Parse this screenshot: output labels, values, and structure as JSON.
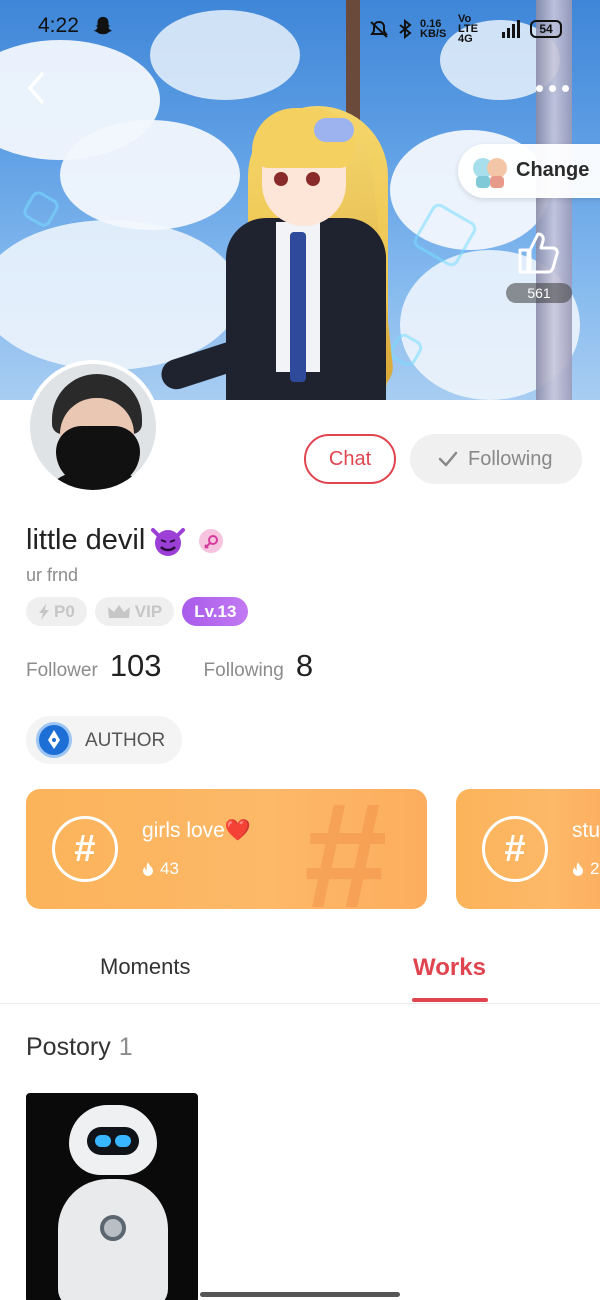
{
  "status_bar": {
    "time": "4:22",
    "net_speed": "0.16 KB/S",
    "network": "Vo LTE 4G",
    "battery": "54"
  },
  "header": {
    "change_label": "Change",
    "like_count": "561"
  },
  "profile": {
    "name": "little devil",
    "bio": "ur frnd",
    "badges": {
      "p0": "P0",
      "vip": "VIP",
      "level": "Lv.13"
    },
    "stats": {
      "follower_label": "Follower",
      "follower_value": "103",
      "following_label": "Following",
      "following_value": "8"
    },
    "author_label": "AUTHOR"
  },
  "actions": {
    "chat_label": "Chat",
    "following_label": "Following"
  },
  "topics": [
    {
      "title": "girls love❤️",
      "count": "43"
    },
    {
      "title": "stu",
      "count": "2"
    }
  ],
  "tabs": [
    {
      "label": "Moments",
      "active": false
    },
    {
      "label": "Works",
      "active": true
    }
  ],
  "works": {
    "section_title": "Postory",
    "section_count": "1"
  },
  "colors": {
    "accent": "#e0444f",
    "level_badge": "#b168ee",
    "topic_card": "#fdb868",
    "author_icon": "#1d6fd6"
  },
  "icons": [
    "back-icon",
    "more-icon",
    "thumbs-up-icon",
    "check-icon",
    "bolt-icon",
    "crown-icon",
    "female-icon",
    "pen-nib-icon",
    "hashtag-icon",
    "flame-icon"
  ]
}
